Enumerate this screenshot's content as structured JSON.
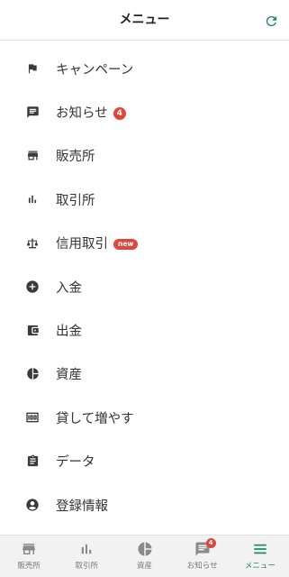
{
  "header": {
    "title": "メニュー"
  },
  "menu": [
    {
      "label": "キャンペーン",
      "icon": "flag-icon"
    },
    {
      "label": "お知らせ",
      "icon": "message-icon",
      "badge": "4"
    },
    {
      "label": "販売所",
      "icon": "store-icon"
    },
    {
      "label": "取引所",
      "icon": "bar-chart-icon"
    },
    {
      "label": "信用取引",
      "icon": "balance-scale-icon",
      "badge": "new"
    },
    {
      "label": "入金",
      "icon": "plus-circle-icon"
    },
    {
      "label": "出金",
      "icon": "wallet-icon"
    },
    {
      "label": "資産",
      "icon": "pie-chart-icon"
    },
    {
      "label": "貸して増やす",
      "icon": "money-icon"
    },
    {
      "label": "データ",
      "icon": "clipboard-icon"
    },
    {
      "label": "登録情報",
      "icon": "account-circle-icon"
    }
  ],
  "tabbar": {
    "items": [
      {
        "label": "販売所",
        "icon": "store-icon"
      },
      {
        "label": "取引所",
        "icon": "bar-chart-icon"
      },
      {
        "label": "資産",
        "icon": "pie-chart-icon"
      },
      {
        "label": "お知らせ",
        "icon": "message-icon",
        "badge": "4"
      },
      {
        "label": "メニュー",
        "icon": "menu-icon",
        "active": true
      }
    ]
  },
  "colors": {
    "accent": "#1f8a6c",
    "badge": "#e0463c",
    "icon": "#3a3a3a",
    "tab_icon": "#8a8a8a"
  }
}
